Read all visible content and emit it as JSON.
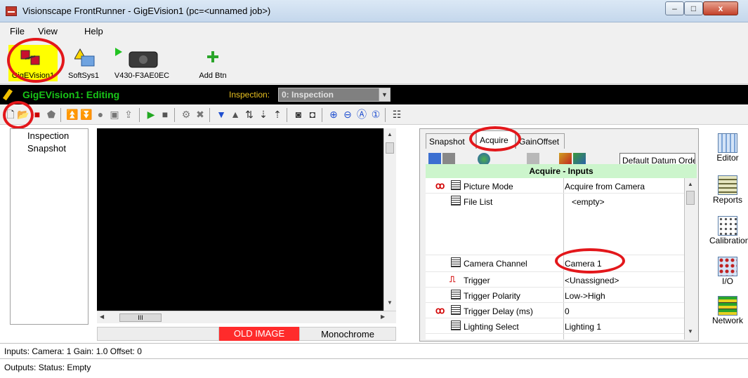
{
  "window": {
    "title": "Visionscape FrontRunner - GigEVision1 (pc=<unnamed job>)",
    "minimize_glyph": "–",
    "maximize_glyph": "□",
    "close_glyph": "x"
  },
  "menu": {
    "items": [
      "File",
      "View",
      "Help"
    ]
  },
  "devices": [
    {
      "label": "GigEVision1",
      "icon": "gige-camera-icon",
      "selected": true
    },
    {
      "label": "SoftSys1",
      "icon": "softsys-icon"
    },
    {
      "label": "V430-F3AE0EC",
      "icon": "v430-camera-icon"
    },
    {
      "label": "Add Btn",
      "icon": "add-icon"
    }
  ],
  "editing": {
    "title": "GigEVision1: Editing",
    "inspection_label": "Inspection:",
    "inspection_value": "0: Inspection"
  },
  "tree": {
    "items": [
      "Inspection",
      "Snapshot"
    ]
  },
  "image_status": {
    "old_image": "OLD IMAGE",
    "mode": "Monochrome",
    "hscroll_grip": "III"
  },
  "panel": {
    "tabs": [
      "Snapshot",
      "Acquire",
      "GainOffset"
    ],
    "datum": "Default Datum Orde",
    "header": "Acquire - Inputs",
    "rows": [
      {
        "name": "Picture Mode",
        "value": "Acquire from Camera",
        "linked": true
      },
      {
        "name": "File List",
        "value": "<empty>"
      },
      {
        "name": "Camera Channel",
        "value": "Camera 1"
      },
      {
        "name": "Trigger",
        "value": "<Unassigned>"
      },
      {
        "name": "Trigger Polarity",
        "value": "Low->High"
      },
      {
        "name": "Trigger Delay (ms)",
        "value": "0",
        "linked": true
      },
      {
        "name": "Lighting Select",
        "value": "Lighting 1"
      }
    ]
  },
  "launcher": [
    "Editor",
    "Reports",
    "Calibration",
    "I/O",
    "Network"
  ],
  "status": {
    "inputs": "Inputs: Camera: 1 Gain: 1.0 Offset: 0",
    "outputs": "Outputs: Status: Empty"
  },
  "colors": {
    "editing_text": "#18c418",
    "old_image_bg": "#ff2b2b",
    "header_bg": "#ccf5cc",
    "highlight_ring": "#e3171b"
  }
}
